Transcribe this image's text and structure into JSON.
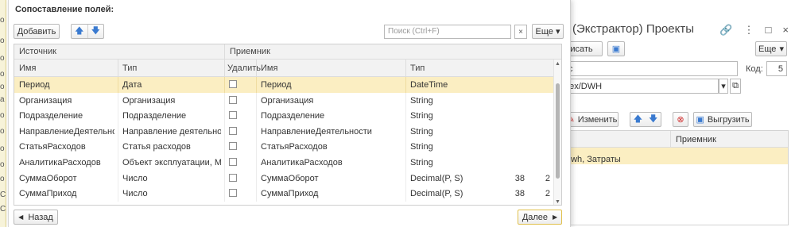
{
  "background_window": {
    "title": "(Экстрактор) Проекты",
    "icons": [
      "link-icon",
      "more-vert-icon",
      "maximize-icon",
      "close-icon"
    ],
    "write_button": "исать",
    "more_button": "Еще",
    "name_value": "кс",
    "code_label": "Код:",
    "code_value": "5",
    "path_value": "dex/DWH",
    "change_button": "Изменить",
    "export_button": "Выгрузить",
    "grid_header": "Приемник",
    "grid_row_value": "dwh, Затраты"
  },
  "left_strip_glyphs": [
    "о",
    "о",
    "о",
    "о",
    "о",
    "а",
    "о",
    "о",
    "о",
    "о",
    "о",
    "С",
    "С"
  ],
  "dialog": {
    "title": "Сопоставление полей:",
    "toolbar": {
      "add_label": "Добавить",
      "search_placeholder": "Поиск (Ctrl+F)",
      "clear_label": "×",
      "more_label": "Еще"
    },
    "table": {
      "group_source": "Источник",
      "group_target": "Приемник",
      "headers": {
        "src_name": "Имя",
        "src_type": "Тип",
        "delete": "Удалить",
        "tgt_name": "Имя",
        "tgt_type": "Тип"
      },
      "rows": [
        {
          "src_name": "Период",
          "src_type": "Дата",
          "delete": false,
          "tgt_name": "Период",
          "tgt_type": "DateTime",
          "p1": "",
          "p2": "",
          "selected": true
        },
        {
          "src_name": "Организация",
          "src_type": "Организация",
          "delete": false,
          "tgt_name": "Организация",
          "tgt_type": "String",
          "p1": "",
          "p2": "",
          "selected": false
        },
        {
          "src_name": "Подразделение",
          "src_type": "Подразделение",
          "delete": false,
          "tgt_name": "Подразделение",
          "tgt_type": "String",
          "p1": "",
          "p2": "",
          "selected": false
        },
        {
          "src_name": "НаправлениеДеятельности",
          "src_type": "Направление деятельности",
          "delete": false,
          "tgt_name": "НаправлениеДеятельности",
          "tgt_type": "String",
          "p1": "",
          "p2": "",
          "selected": false
        },
        {
          "src_name": "СтатьяРасходов",
          "src_type": "Статья расходов",
          "delete": false,
          "tgt_name": "СтатьяРасходов",
          "tgt_type": "String",
          "p1": "",
          "p2": "",
          "selected": false
        },
        {
          "src_name": "АналитикаРасходов",
          "src_type": "Объект эксплуатации, Мар...",
          "delete": false,
          "tgt_name": "АналитикаРасходов",
          "tgt_type": "String",
          "p1": "",
          "p2": "",
          "selected": false
        },
        {
          "src_name": "СуммаОборот",
          "src_type": "Число",
          "delete": false,
          "tgt_name": "СуммаОборот",
          "tgt_type": "Decimal(P, S)",
          "p1": "38",
          "p2": "2",
          "selected": false
        },
        {
          "src_name": "СуммаПриход",
          "src_type": "Число",
          "delete": false,
          "tgt_name": "СуммаПриход",
          "tgt_type": "Decimal(P, S)",
          "p1": "38",
          "p2": "2",
          "selected": false
        }
      ]
    },
    "footer": {
      "back_label": "Назад",
      "next_label": "Далее"
    }
  }
}
